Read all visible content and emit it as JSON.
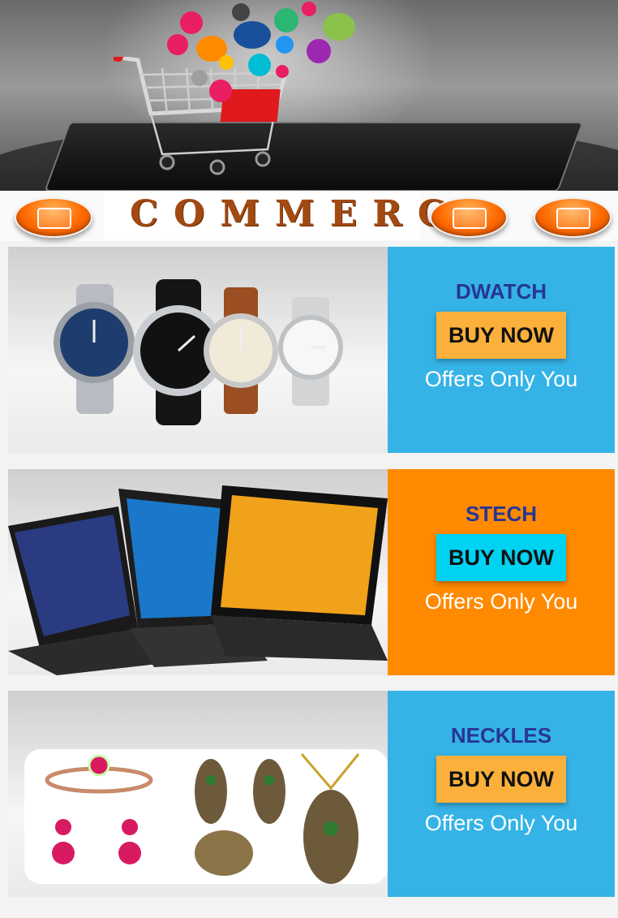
{
  "header": {
    "brand": "Commerce"
  },
  "nav": {
    "icons": [
      "refresh-icon",
      "group-icon",
      "globe-search-icon"
    ]
  },
  "products": [
    {
      "name": "DWATCH",
      "button": "BUY NOW",
      "offer": "Offers Only You",
      "panel_color": "#35b3e6",
      "button_color": "#fbb03b",
      "image": "watches"
    },
    {
      "name": "STECH",
      "button": "BUY NOW",
      "offer": "Offers Only You",
      "panel_color": "#ff8a00",
      "button_color": "#00d2f2",
      "image": "laptops"
    },
    {
      "name": "NECKLES",
      "button": "BUY NOW",
      "offer": "Offers Only You",
      "panel_color": "#35b3e6",
      "button_color": "#fbb03b",
      "image": "jewelry"
    }
  ]
}
